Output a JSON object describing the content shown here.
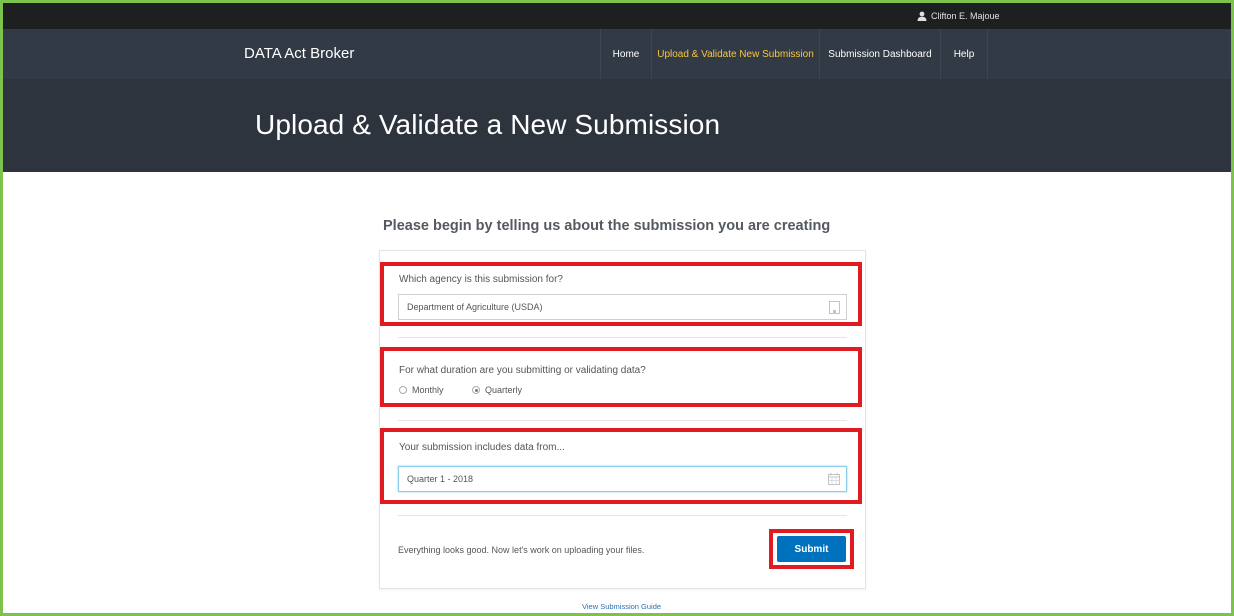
{
  "header": {
    "user_name": "Clifton E. Majoue",
    "brand": "DATA Act Broker",
    "nav": [
      {
        "label": "Home",
        "active": false
      },
      {
        "label": "Upload & Validate New Submission",
        "active": true
      },
      {
        "label": "Submission Dashboard",
        "active": false
      },
      {
        "label": "Help",
        "active": false
      }
    ]
  },
  "hero": {
    "title": "Upload & Validate a New Submission"
  },
  "form": {
    "intro": "Please begin by telling us about the submission you are creating",
    "agency": {
      "label": "Which agency is this submission for?",
      "value": "Department of Agriculture (USDA)"
    },
    "duration": {
      "label": "For what duration are you submitting or validating data?",
      "options": [
        {
          "label": "Monthly",
          "checked": false
        },
        {
          "label": "Quarterly",
          "checked": true
        }
      ]
    },
    "period": {
      "label": "Your submission includes data from...",
      "value": "Quarter 1 - 2018"
    },
    "status_text": "Everything looks good. Now let's work on uploading your files.",
    "submit_label": "Submit",
    "guide_link": "View Submission Guide"
  },
  "colors": {
    "highlight": "#e21a22",
    "accent": "#0071bc",
    "nav_active": "#f6c744",
    "frame": "#7dc24b"
  },
  "icons": [
    "user-icon",
    "building-icon",
    "calendar-icon"
  ]
}
